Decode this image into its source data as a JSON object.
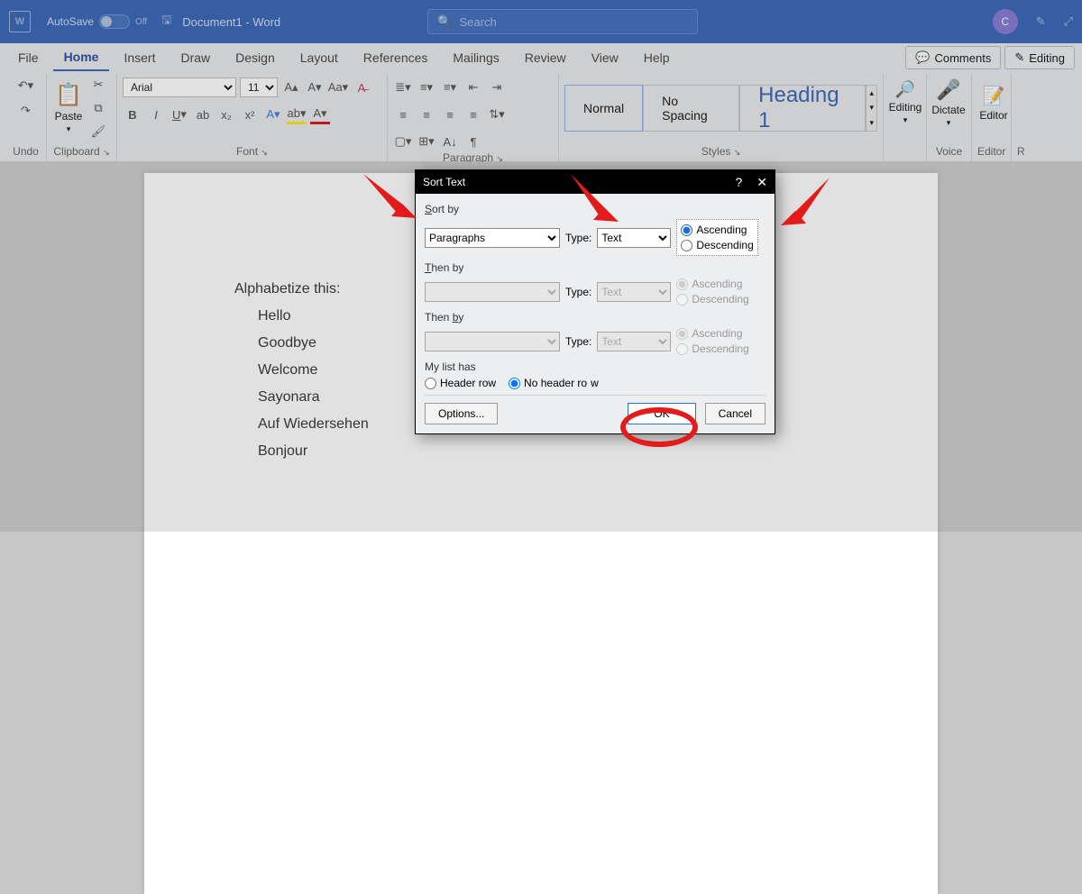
{
  "titlebar": {
    "autosave_label": "AutoSave",
    "autosave_state": "Off",
    "doc_title": "Document1 - Word",
    "search_placeholder": "Search",
    "avatar_initial": "C"
  },
  "tabs": [
    "File",
    "Home",
    "Insert",
    "Draw",
    "Design",
    "Layout",
    "References",
    "Mailings",
    "Review",
    "View",
    "Help"
  ],
  "actions": {
    "comments": "Comments",
    "editing": "Editing"
  },
  "ribbon": {
    "undo_label": "Undo",
    "clipboard_label": "Clipboard",
    "paste_label": "Paste",
    "font_label": "Font",
    "font_family": "Arial",
    "font_size": "11",
    "paragraph_label": "Paragraph",
    "styles_label": "Styles",
    "style_normal": "Normal",
    "style_nospacing": "No Spacing",
    "style_heading1": "Heading 1",
    "voice_label": "Voice",
    "editing_label": "Editing",
    "editor_label": "Editor",
    "dictate_label": "Dictate",
    "editorbtn_label": "Editor",
    "r_label": "R"
  },
  "document": {
    "heading": "Alphabetize this:",
    "items": [
      "Hello",
      "Goodbye",
      "Welcome",
      "Sayonara",
      "Auf Wiedersehen",
      "Bonjour"
    ]
  },
  "dialog": {
    "title": "Sort Text",
    "sort_by": "Sort by",
    "then_by": "Then by",
    "type_label": "Type:",
    "field_value": "Paragraphs",
    "type_value": "Text",
    "ascending": "Ascending",
    "descending": "Descending",
    "my_list_has": "My list has",
    "header_row": "Header row",
    "no_header_row": "No header row",
    "options": "Options...",
    "ok": "OK",
    "cancel": "Cancel"
  }
}
